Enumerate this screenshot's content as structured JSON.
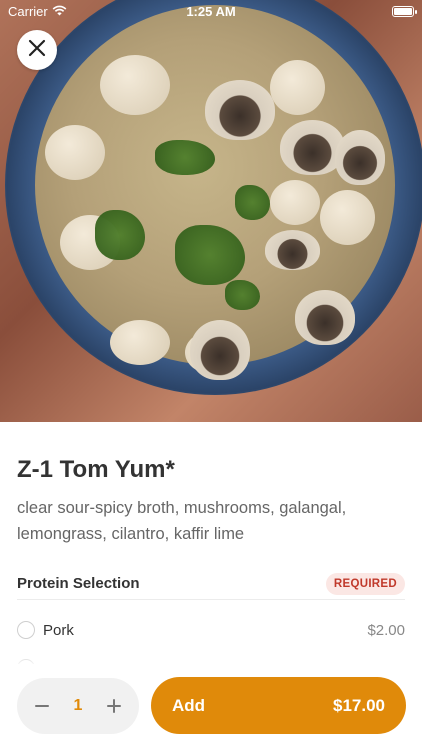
{
  "status_bar": {
    "carrier": "Carrier",
    "time": "1:25 AM"
  },
  "hero": {
    "image": "tom-yum-soup-photo"
  },
  "item": {
    "title": "Z-1 Tom Yum*",
    "description": "clear sour-spicy broth, mushrooms, galangal, lemongrass, cilantro, kaffir lime"
  },
  "protein_section": {
    "title": "Protein Selection",
    "badge": "REQUIRED",
    "options": [
      {
        "label": "Pork",
        "price": "$2.00"
      }
    ]
  },
  "footer": {
    "quantity": "1",
    "add_label": "Add",
    "add_price": "$17.00"
  },
  "colors": {
    "accent": "#e08a0a",
    "required_bg": "#fbe7e4",
    "required_text": "#c0392b"
  },
  "icons": [
    "close-icon",
    "wifi-icon",
    "battery-icon",
    "minus-icon",
    "plus-icon"
  ]
}
